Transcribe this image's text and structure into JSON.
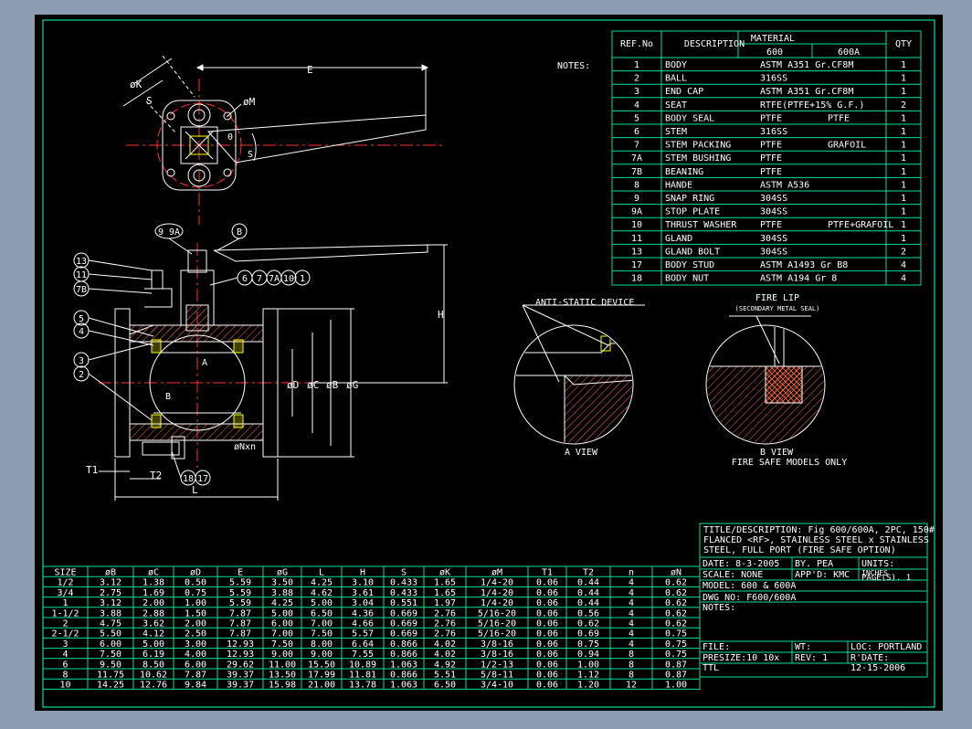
{
  "colors": {
    "sheet_bg": "#000000",
    "frame": "#00e0a0",
    "drawing": "#ffffff",
    "centerline": "#ff3030",
    "hatch": "#ff6a3d",
    "highlight": "#ffff00"
  },
  "notes_label": "NOTES:",
  "material_table": {
    "headers": {
      "ref": "REF.No",
      "description": "DESCRIPTION",
      "material": "MATERIAL",
      "col600": "600",
      "col600a": "600A",
      "qty": "QTY"
    },
    "rows": [
      {
        "ref": "1",
        "desc": "BODY",
        "m1": "ASTM A351 Gr.CF8M",
        "m2": "",
        "qty": "1"
      },
      {
        "ref": "2",
        "desc": "BALL",
        "m1": "316SS",
        "m2": "",
        "qty": "1"
      },
      {
        "ref": "3",
        "desc": "END CAP",
        "m1": "ASTM A351 Gr.CF8M",
        "m2": "",
        "qty": "1"
      },
      {
        "ref": "4",
        "desc": "SEAT",
        "m1": "RTFE(PTFE+15% G.F.)",
        "m2": "",
        "qty": "2"
      },
      {
        "ref": "5",
        "desc": "BODY SEAL",
        "m1": "PTFE",
        "m2": "PTFE",
        "qty": "1"
      },
      {
        "ref": "6",
        "desc": "STEM",
        "m1": "316SS",
        "m2": "",
        "qty": "1"
      },
      {
        "ref": "7",
        "desc": "STEM PACKING",
        "m1": "PTFE",
        "m2": "GRAFOIL",
        "qty": "1"
      },
      {
        "ref": "7A",
        "desc": "STEM BUSHING",
        "m1": "PTFE",
        "m2": "",
        "qty": "1"
      },
      {
        "ref": "7B",
        "desc": "BEANING",
        "m1": "PTFE",
        "m2": "",
        "qty": "1"
      },
      {
        "ref": "8",
        "desc": "HANDE",
        "m1": "ASTM A536",
        "m2": "",
        "qty": "1"
      },
      {
        "ref": "9",
        "desc": "SNAP RING",
        "m1": "304SS",
        "m2": "",
        "qty": "1"
      },
      {
        "ref": "9A",
        "desc": "STOP PLATE",
        "m1": "304SS",
        "m2": "",
        "qty": "1"
      },
      {
        "ref": "10",
        "desc": "THRUST WASHER",
        "m1": "PTFE",
        "m2": "PTFE+GRAFOIL",
        "qty": "1"
      },
      {
        "ref": "11",
        "desc": "GLAND",
        "m1": "304SS",
        "m2": "",
        "qty": "1"
      },
      {
        "ref": "13",
        "desc": "GLAND BOLT",
        "m1": "304SS",
        "m2": "",
        "qty": "2"
      },
      {
        "ref": "17",
        "desc": "BODY STUD",
        "m1": "ASTM A1493 Gr B8",
        "m2": "",
        "qty": "4"
      },
      {
        "ref": "18",
        "desc": "BODY NUT",
        "m1": "ASTM A194 Gr 8",
        "m2": "",
        "qty": "4"
      }
    ]
  },
  "dimension_table": {
    "headers": [
      "SIZE",
      "øB",
      "øC",
      "øD",
      "E",
      "øG",
      "L",
      "H",
      "S",
      "øK",
      "øM",
      "T1",
      "T2",
      "n",
      "øN"
    ],
    "rows": [
      [
        "1/2",
        "3.12",
        "1.38",
        "0.50",
        "5.59",
        "3.50",
        "4.25",
        "3.10",
        "0.433",
        "1.65",
        "1/4-20",
        "0.06",
        "0.44",
        "4",
        "0.62"
      ],
      [
        "3/4",
        "2.75",
        "1.69",
        "0.75",
        "5.59",
        "3.88",
        "4.62",
        "3.61",
        "0.433",
        "1.65",
        "1/4-20",
        "0.06",
        "0.44",
        "4",
        "0.62"
      ],
      [
        "1",
        "3.12",
        "2.00",
        "1.00",
        "5.59",
        "4.25",
        "5.00",
        "3.04",
        "0.551",
        "1.97",
        "1/4-20",
        "0.06",
        "0.44",
        "4",
        "0.62"
      ],
      [
        "1-1/2",
        "3.88",
        "2.88",
        "1.50",
        "7.87",
        "5.00",
        "6.50",
        "4.36",
        "0.669",
        "2.76",
        "5/16-20",
        "0.06",
        "0.56",
        "4",
        "0.62"
      ],
      [
        "2",
        "4.75",
        "3.62",
        "2.00",
        "7.87",
        "6.00",
        "7.00",
        "4.66",
        "0.669",
        "2.76",
        "5/16-20",
        "0.06",
        "0.62",
        "4",
        "0.62"
      ],
      [
        "2-1/2",
        "5.50",
        "4.12",
        "2.50",
        "7.87",
        "7.00",
        "7.50",
        "5.57",
        "0.669",
        "2.76",
        "5/16-20",
        "0.06",
        "0.69",
        "4",
        "0.75"
      ],
      [
        "3",
        "6.00",
        "5.00",
        "3.00",
        "12.93",
        "7.50",
        "8.00",
        "6.64",
        "0.866",
        "4.02",
        "3/8-16",
        "0.06",
        "0.75",
        "4",
        "0.75"
      ],
      [
        "4",
        "7.50",
        "6.19",
        "4.00",
        "12.93",
        "9.00",
        "9.00",
        "7.55",
        "0.866",
        "4.02",
        "3/8-16",
        "0.06",
        "0.94",
        "8",
        "0.75"
      ],
      [
        "6",
        "9.50",
        "8.50",
        "6.00",
        "29.62",
        "11.00",
        "15.50",
        "10.89",
        "1.063",
        "4.92",
        "1/2-13",
        "0.06",
        "1.00",
        "8",
        "0.87"
      ],
      [
        "8",
        "11.75",
        "10.62",
        "7.87",
        "39.37",
        "13.50",
        "17.99",
        "11.81",
        "0.866",
        "5.51",
        "5/8-11",
        "0.06",
        "1.12",
        "8",
        "0.87"
      ],
      [
        "10",
        "14.25",
        "12.76",
        "9.84",
        "39.37",
        "15.98",
        "21.00",
        "13.78",
        "1.063",
        "6.50",
        "3/4-10",
        "0.06",
        "1.20",
        "12",
        "1.00"
      ]
    ]
  },
  "title_block": {
    "title_line1": "TITLE/DESCRIPTION: Fig 600/600A, 2PC, 150#",
    "title_line2": "FLANCED <RF>, STAINLESS STEEL x STAINLESS",
    "title_line3": "STEEL, FULL PORT (FIRE SAFE OPTION)",
    "date": "DATE:  8-3-2005",
    "by": "BY.  PEA",
    "units": "UNITS:",
    "units_val": "INCHES",
    "scale": "SCALE:  NONE",
    "appd": "APP'D:  KMC",
    "pages": "PAGE(S).  1",
    "model": "MODEL:  600 & 600A",
    "dwg": "DWG NO:  F600/600A",
    "notes": "NOTES:",
    "file": "FILE:",
    "wt": "WT:",
    "loc": "LOC:  PORTLAND",
    "presize": "PRESIZE:10 10x",
    "rev": "REV:  1",
    "rdate": "R'DATE:",
    "ttl": "TTL",
    "rdate_val": "12-15-2006"
  },
  "drawing_labels": {
    "dim_E": "E",
    "dim_K": "øK",
    "dim_S": "S",
    "dim_M": "øM",
    "dim_H": "H",
    "dim_D": "øD",
    "dim_C": "øC",
    "dim_B": "øB",
    "dim_G": "øG",
    "dim_L": "L",
    "dim_T1": "T1",
    "dim_T2": "T2",
    "dim_N": "øNxn",
    "angle_0": "0",
    "angle_s": "S",
    "section_a": "A",
    "section_b": "B",
    "balloon_9_9a": "9 9A",
    "balloon_b": "B",
    "balloon_13": "13",
    "balloon_11": "11",
    "balloon_7b": "7B",
    "balloon_6": "6",
    "balloon_7": "7",
    "balloon_7a": "7A",
    "balloon_10": "10",
    "balloon_1": "1",
    "balloon_5": "5",
    "balloon_4": "4",
    "balloon_3": "3",
    "balloon_2": "2",
    "balloon_18": "18",
    "balloon_17": "17",
    "anti_static": "ANTI-STATIC DEVICE",
    "a_view": "A VIEW",
    "fire_lip": "FIRE LIP",
    "fire_lip_sub": "(SECONDARY METAL SEAL)",
    "b_view": "B VIEW",
    "fire_safe_only": "FIRE SAFE MODELS ONLY"
  }
}
